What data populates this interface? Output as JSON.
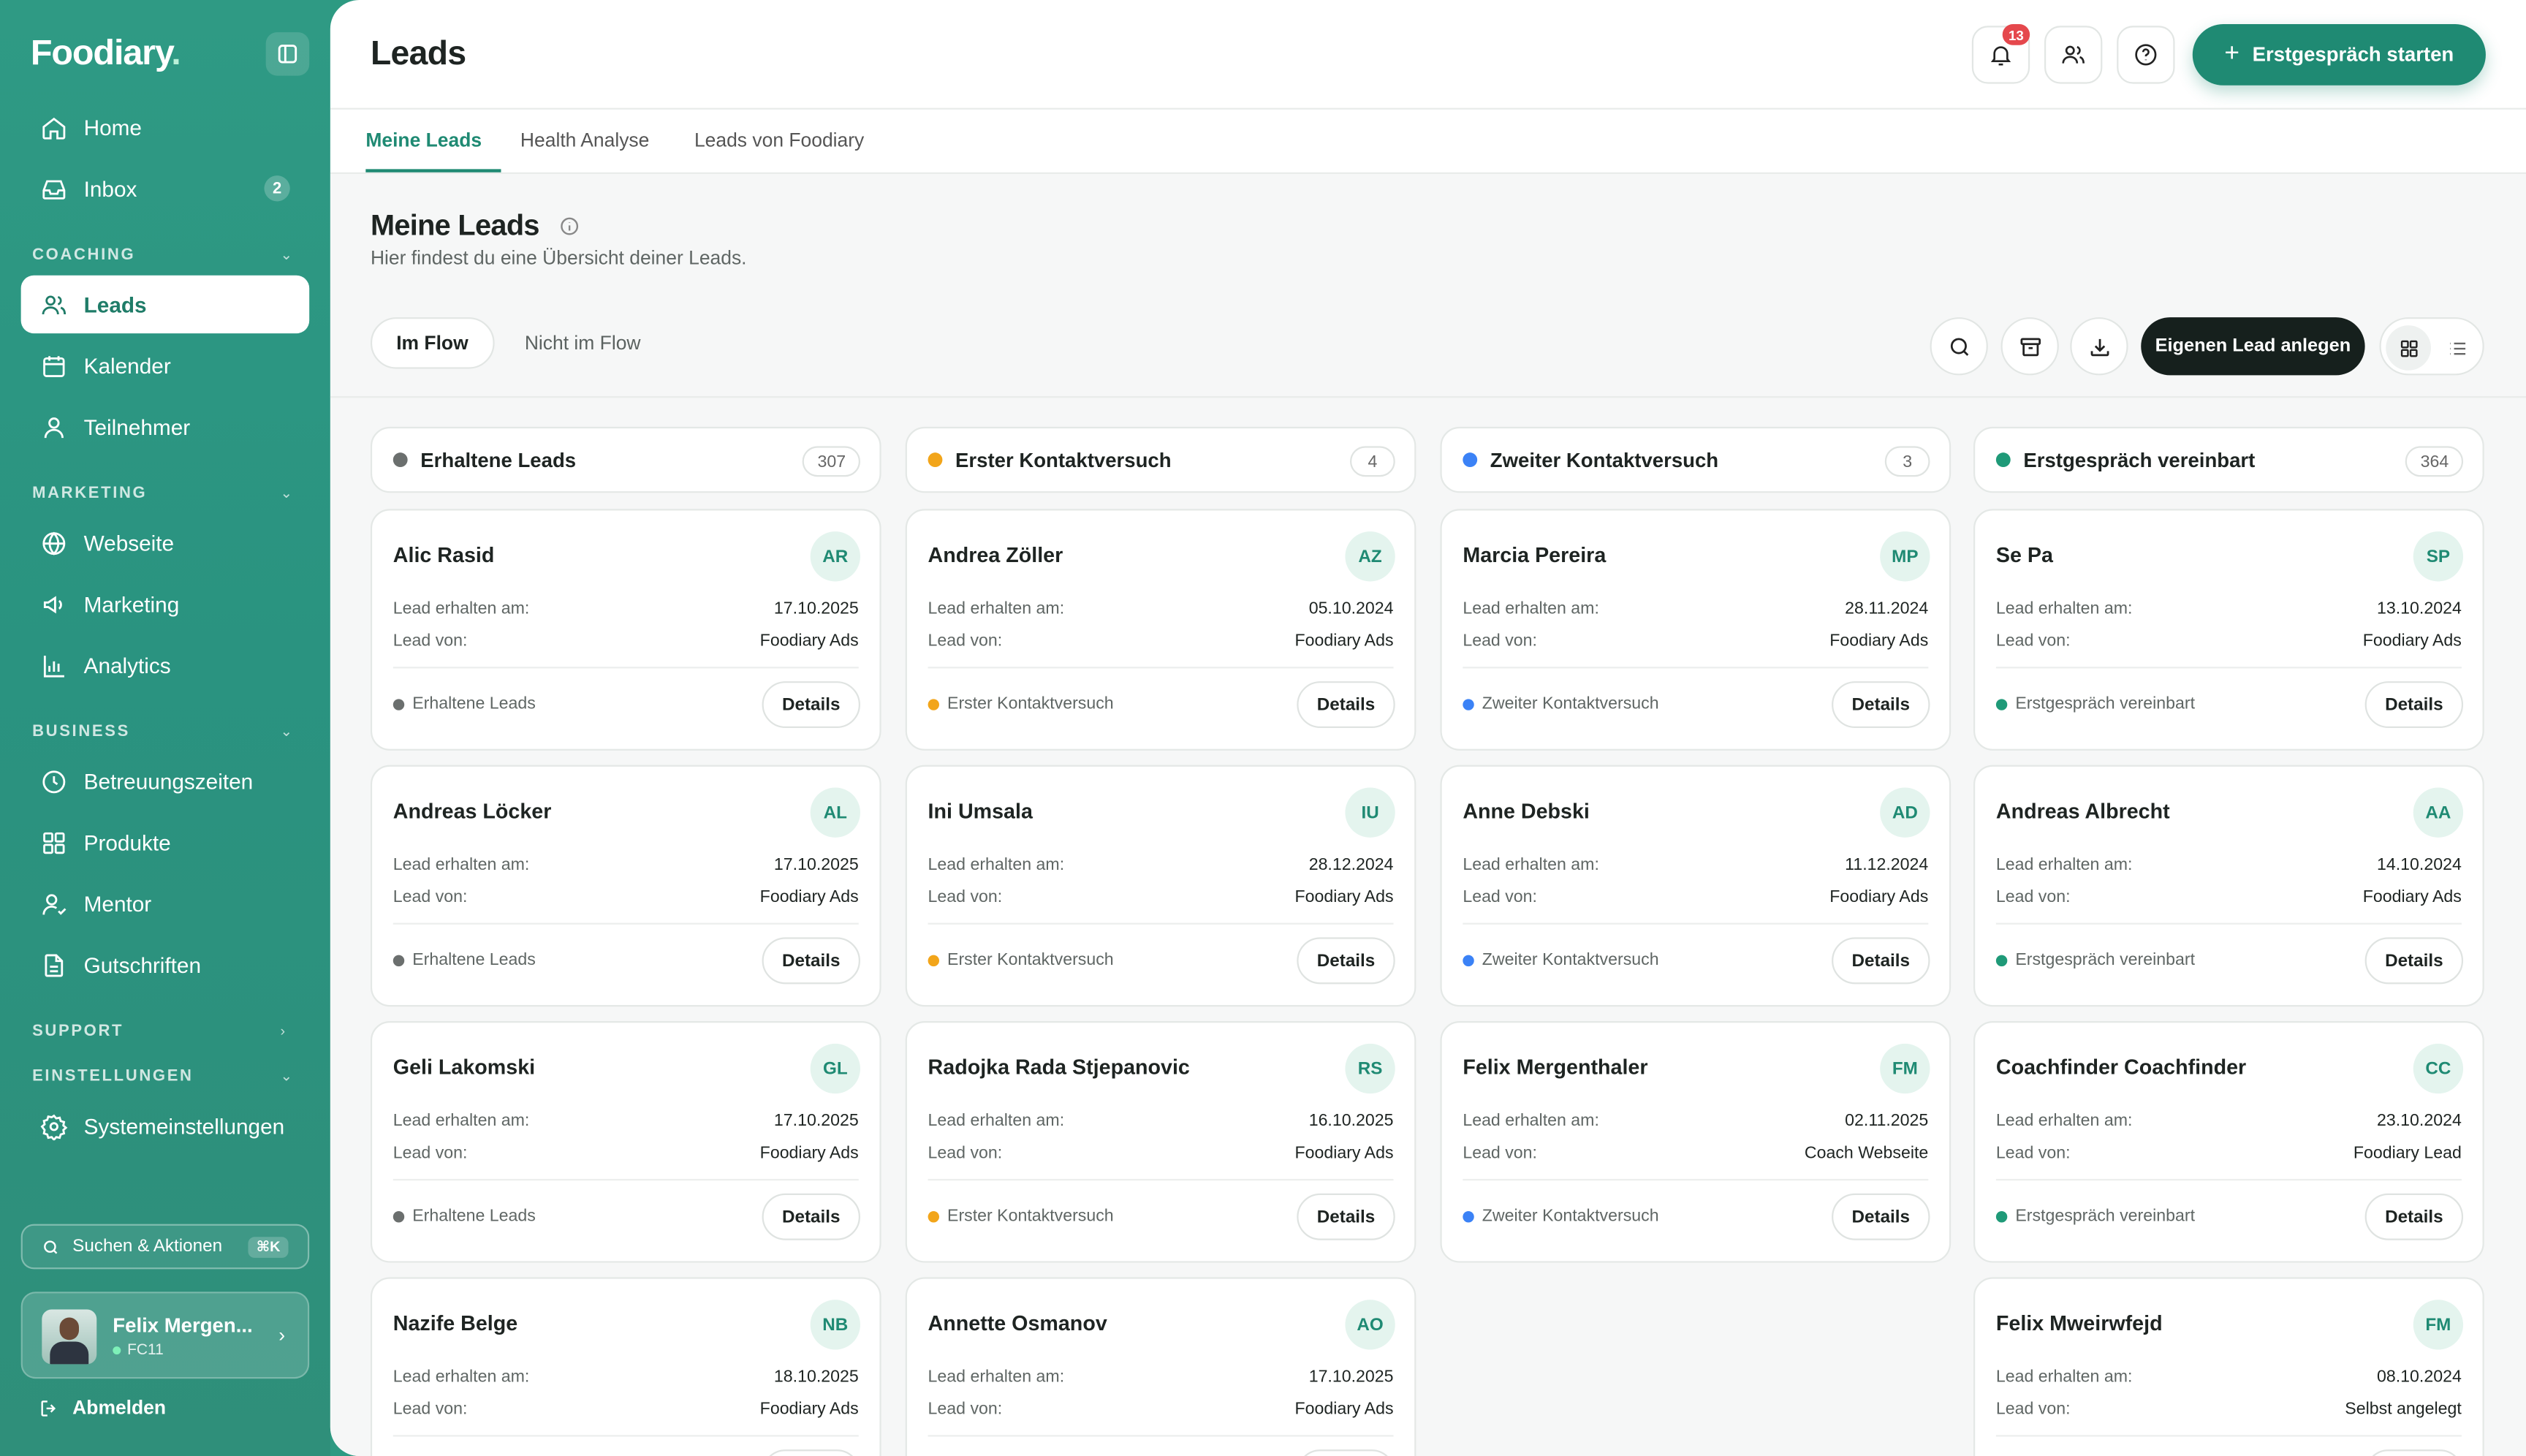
{
  "sidebar": {
    "logo": "Foodiary",
    "nav_top": [
      {
        "label": "Home",
        "icon": "home-icon"
      },
      {
        "label": "Inbox",
        "icon": "inbox-icon",
        "badge": "2"
      }
    ],
    "sections": {
      "coaching": "COACHING",
      "marketing": "MARKETING",
      "business": "BUSINESS",
      "support": "SUPPORT",
      "einstellungen": "EINSTELLUNGEN"
    },
    "coaching_items": [
      "Leads",
      "Kalender",
      "Teilnehmer"
    ],
    "marketing_items": [
      "Webseite",
      "Marketing",
      "Analytics"
    ],
    "business_items": [
      "Betreuungszeiten",
      "Produkte",
      "Mentor",
      "Gutschriften"
    ],
    "settings_items": [
      "Systemeinstellungen"
    ],
    "search": {
      "label": "Suchen & Aktionen",
      "shortcut": "⌘K"
    },
    "user": {
      "name": "Felix Mergen...",
      "code": "FC11"
    },
    "logout": "Abmelden"
  },
  "header": {
    "title": "Leads",
    "notification_count": "13",
    "primary_button": "Erstgespräch starten"
  },
  "tabs": [
    "Meine Leads",
    "Health Analyse",
    "Leads von Foodiary"
  ],
  "section": {
    "title": "Meine Leads",
    "subtitle": "Hier findest du eine Übersicht deiner Leads.",
    "filters": [
      "Im Flow",
      "Nicht im Flow"
    ],
    "create_button": "Eigenen Lead anlegen"
  },
  "colors": {
    "accent": "#1f8a73",
    "erhaltene": "#6b6f6e",
    "erster": "#f2a51a",
    "zweiter": "#3b82f6",
    "erstgespraech": "#1f9a78"
  },
  "card_labels": {
    "received": "Lead erhalten am:",
    "source": "Lead von:",
    "details": "Details"
  },
  "columns": [
    {
      "title": "Erhaltene Leads",
      "count": "307",
      "color": "#6b6f6e",
      "cards": [
        {
          "name": "Alic Rasid",
          "initials": "AR",
          "date": "17.10.2025",
          "source": "Foodiary Ads"
        },
        {
          "name": "Andreas Löcker",
          "initials": "AL",
          "date": "17.10.2025",
          "source": "Foodiary Ads"
        },
        {
          "name": "Geli Lakomski",
          "initials": "GL",
          "date": "17.10.2025",
          "source": "Foodiary Ads"
        },
        {
          "name": "Nazife Belge",
          "initials": "NB",
          "date": "18.10.2025",
          "source": "Foodiary Ads"
        }
      ]
    },
    {
      "title": "Erster Kontaktversuch",
      "count": "4",
      "color": "#f2a51a",
      "cards": [
        {
          "name": "Andrea Zöller",
          "initials": "AZ",
          "date": "05.10.2024",
          "source": "Foodiary Ads"
        },
        {
          "name": "Ini Umsala",
          "initials": "IU",
          "date": "28.12.2024",
          "source": "Foodiary Ads"
        },
        {
          "name": "Radojka Rada Stjepanovic",
          "initials": "RS",
          "date": "16.10.2025",
          "source": "Foodiary Ads"
        },
        {
          "name": "Annette Osmanov",
          "initials": "AO",
          "date": "17.10.2025",
          "source": "Foodiary Ads"
        }
      ]
    },
    {
      "title": "Zweiter Kontaktversuch",
      "count": "3",
      "color": "#3b82f6",
      "cards": [
        {
          "name": "Marcia Pereira",
          "initials": "MP",
          "date": "28.11.2024",
          "source": "Foodiary Ads"
        },
        {
          "name": "Anne Debski",
          "initials": "AD",
          "date": "11.12.2024",
          "source": "Foodiary Ads"
        },
        {
          "name": "Felix Mergenthaler",
          "initials": "FM",
          "date": "02.11.2025",
          "source": "Coach Webseite"
        }
      ]
    },
    {
      "title": "Erstgespräch vereinbart",
      "count": "364",
      "color": "#1f9a78",
      "cards": [
        {
          "name": "Se Pa",
          "initials": "SP",
          "date": "13.10.2024",
          "source": "Foodiary Ads"
        },
        {
          "name": "Andreas Albrecht",
          "initials": "AA",
          "date": "14.10.2024",
          "source": "Foodiary Ads"
        },
        {
          "name": "Coachfinder Coachfinder",
          "initials": "CC",
          "date": "23.10.2024",
          "source": "Foodiary Lead"
        },
        {
          "name": "Felix Mweirwfejd",
          "initials": "FM",
          "date": "08.10.2024",
          "source": "Selbst angelegt"
        }
      ]
    }
  ]
}
